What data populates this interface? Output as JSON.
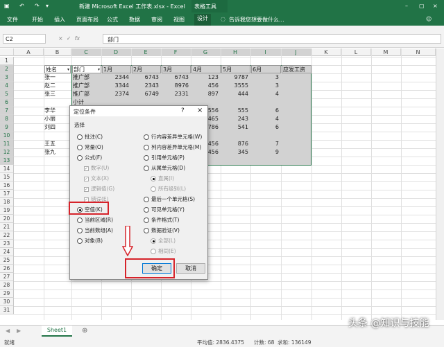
{
  "titlebar": {
    "file_title": "新建 Microsoft Excel 工作表.xlsx - Excel",
    "context_tab": "表格工具",
    "quick_icons": [
      "save-icon",
      "undo-icon",
      "redo-icon"
    ]
  },
  "ribbon": {
    "tabs": [
      "文件",
      "开始",
      "插入",
      "页面布局",
      "公式",
      "数据",
      "审阅",
      "视图",
      "设计"
    ],
    "active_tab": "设计",
    "tell_me": "告诉我您想要做什么..."
  },
  "formula_bar": {
    "name_box": "C2",
    "value": "部门"
  },
  "columns": [
    "A",
    "B",
    "C",
    "D",
    "E",
    "F",
    "G",
    "H",
    "I",
    "J",
    "K",
    "L",
    "M",
    "N"
  ],
  "rows": [
    "1",
    "2",
    "3",
    "4",
    "5",
    "6",
    "7",
    "8",
    "9",
    "10",
    "11",
    "12",
    "13",
    "14",
    "15",
    "16",
    "17",
    "18",
    "19",
    "20",
    "21",
    "22",
    "23",
    "24",
    "25",
    "26",
    "27",
    "28",
    "29",
    "30",
    "31"
  ],
  "table": {
    "headers": [
      "姓名",
      "部门",
      "1月",
      "2月",
      "3月",
      "4月",
      "5月",
      "6月",
      "应发工资"
    ],
    "names": [
      "张一",
      "赵二",
      "张三",
      "",
      "李华",
      "小丽",
      "刘四",
      "",
      "王五",
      "张九"
    ],
    "depts": [
      "推广部",
      "推广部",
      "推广部",
      "小计"
    ],
    "values": [
      [
        "2344",
        "6743",
        "6743",
        "123",
        "9787",
        "3"
      ],
      [
        "3344",
        "2343",
        "8976",
        "456",
        "3555",
        "3"
      ],
      [
        "2374",
        "6749",
        "2331",
        "897",
        "444",
        "4"
      ]
    ],
    "lower": [
      [
        "556",
        "555",
        "6"
      ],
      [
        "465",
        "243",
        "4"
      ],
      [
        "786",
        "541",
        "6"
      ],
      [
        "",
        "",
        " "
      ],
      [
        "456",
        "876",
        "7"
      ],
      [
        "456",
        "345",
        "9"
      ]
    ]
  },
  "dialog": {
    "title": "定位条件",
    "help": "?",
    "close": "×",
    "section": "选择",
    "left_options": [
      "批注(C)",
      "常量(O)",
      "公式(F)"
    ],
    "formula_subs": [
      "数字(U)",
      "文本(X)",
      "逻辑值(G)",
      "错误(E)"
    ],
    "left_options2": [
      "空值(K)",
      "当前区域(R)",
      "当前数组(A)",
      "对象(B)"
    ],
    "right_options": [
      "行内容差异单元格(W)",
      "列内容差异单元格(M)",
      "引用单元格(P)",
      "从属单元格(D)"
    ],
    "right_subs": [
      "直属(I)",
      "所有级别(L)"
    ],
    "right_options2": [
      "最后一个单元格(S)",
      "可见单元格(Y)",
      "条件格式(T)",
      "数据验证(V)"
    ],
    "validation_subs": [
      "全部(L)",
      "相同(E)"
    ],
    "ok": "确定",
    "cancel": "取消"
  },
  "sheet": {
    "tab": "Sheet1",
    "add": "⊕"
  },
  "status": {
    "ready": "就绪",
    "average": "平均值: 2836.4375",
    "count": "计数: 68",
    "sum": "求和: 136149"
  },
  "watermark": "头条 @知识与技能",
  "colors": {
    "excel_green": "#217346",
    "highlight_red": "#d6232a"
  }
}
